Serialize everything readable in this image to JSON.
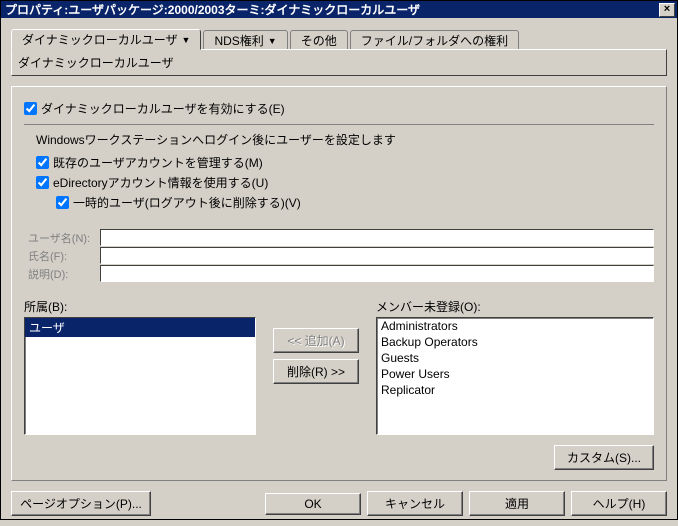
{
  "window": {
    "title": "プロパティ:ユーザパッケージ:2000/2003ターミ:ダイナミックローカルユーザ",
    "close_label": "×"
  },
  "tabs": {
    "main": [
      {
        "label": "ダイナミックローカルユーザ",
        "has_dropdown": true,
        "active": true
      },
      {
        "label": "NDS権利",
        "has_dropdown": true
      },
      {
        "label": "その他"
      },
      {
        "label": "ファイル/フォルダへの権利"
      }
    ],
    "sub_label": "ダイナミックローカルユーザ"
  },
  "panel": {
    "enable_label": "ダイナミックローカルユーザを有効にする(E)",
    "enable_checked": true,
    "description": "Windowsワークステーションへログイン後にユーザーを設定します",
    "manage_label": "既存のユーザアカウントを管理する(M)",
    "manage_checked": true,
    "edir_label": "eDirectoryアカウント情報を使用する(U)",
    "edir_checked": true,
    "volatile_label": "一時的ユーザ(ログアウト後に削除する)(V)",
    "volatile_checked": true,
    "fields": {
      "username_label": "ユーザ名(N):",
      "username_value": "",
      "fullname_label": "氏名(F):",
      "fullname_value": "",
      "description_label": "説明(D):",
      "description_value": ""
    },
    "member_label": "所属(B):",
    "member_items": [
      "ユーザ"
    ],
    "buttons": {
      "add": "<< 追加(A)",
      "remove": "削除(R) >>"
    },
    "notmember_label": "メンバー未登録(O):",
    "notmember_items": [
      "Administrators",
      "Backup Operators",
      "Guests",
      "Power Users",
      "Replicator"
    ],
    "custom_button": "カスタム(S)..."
  },
  "footer": {
    "page_options": "ページオプション(P)...",
    "ok": "OK",
    "cancel": "キャンセル",
    "apply": "適用",
    "help": "ヘルプ(H)"
  }
}
